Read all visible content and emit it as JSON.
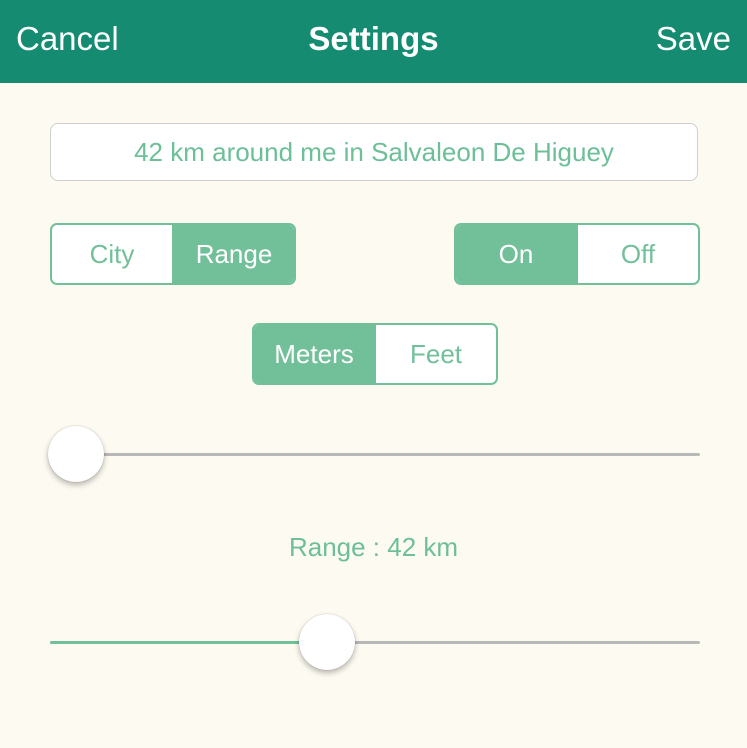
{
  "navbar": {
    "cancel_label": "Cancel",
    "title": "Settings",
    "save_label": "Save"
  },
  "location": {
    "text": "42 km around me in Salvaleon De Higuey"
  },
  "mode_toggle": {
    "options": [
      "City",
      "Range"
    ],
    "selected": "Range"
  },
  "on_off_toggle": {
    "options": [
      "On",
      "Off"
    ],
    "selected": "On"
  },
  "units_toggle": {
    "options": [
      "Meters",
      "Feet"
    ],
    "selected": "Meters"
  },
  "top_slider": {
    "level": 0.04
  },
  "range_slider": {
    "label": "Range : 42 km",
    "level": 0.426
  },
  "colors": {
    "navbar": "#158b71",
    "accent": "#72c09a",
    "background": "#fdfbf1"
  }
}
